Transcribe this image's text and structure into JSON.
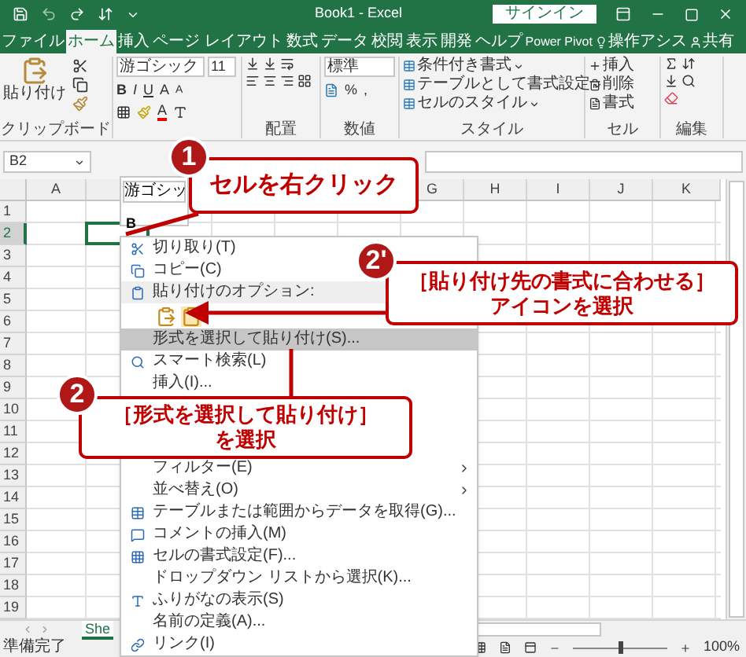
{
  "title_bar": {
    "title": "Book1  -  Excel",
    "sign_in": "サインイン"
  },
  "tabs": [
    {
      "label": "ファイル",
      "selected": false,
      "kind": "plain"
    },
    {
      "label": "ホーム",
      "selected": true,
      "kind": "plain"
    },
    {
      "label": "挿入",
      "selected": false,
      "kind": "plain"
    },
    {
      "label": "ページ レイアウト",
      "selected": false,
      "kind": "plain"
    },
    {
      "label": "数式",
      "selected": false,
      "kind": "plain"
    },
    {
      "label": "データ",
      "selected": false,
      "kind": "plain"
    },
    {
      "label": "校閲",
      "selected": false,
      "kind": "plain"
    },
    {
      "label": "表示",
      "selected": false,
      "kind": "plain"
    },
    {
      "label": "開発",
      "selected": false,
      "kind": "plain"
    },
    {
      "label": "ヘルプ",
      "selected": false,
      "kind": "plain"
    },
    {
      "label": "Power Pivot",
      "selected": false,
      "kind": "plain"
    },
    {
      "label": "操作アシス",
      "selected": false,
      "kind": "search"
    },
    {
      "label": "共有",
      "selected": false,
      "kind": "share"
    }
  ],
  "ribbon": {
    "clipboard": {
      "paste": "貼り付け",
      "label": "クリップボード"
    },
    "font": {
      "name": "游ゴシック",
      "size": "11",
      "styles": [
        "B",
        "I",
        "U"
      ],
      "grow": "A",
      "shrink": "A",
      "font_color_button": "A"
    },
    "alignment": {
      "label": "配置"
    },
    "number": {
      "format": "標準",
      "percent": "%",
      "comma": ",",
      "label": "数値"
    },
    "styles": {
      "items": [
        "条件付き書式",
        "テーブルとして書式設定",
        "セルのスタイル"
      ],
      "label": "スタイル"
    },
    "cells": {
      "items": [
        "挿入",
        "削除",
        "書式"
      ],
      "label": "セル"
    },
    "editing": {
      "label": "編集"
    }
  },
  "formula_bar": {
    "name_box": "B2"
  },
  "mini_toolbar": {
    "font": "游ゴシッ",
    "bold": "B"
  },
  "columns": [
    {
      "label": "A"
    },
    {
      "label": "G"
    },
    {
      "label": "H"
    },
    {
      "label": "I"
    },
    {
      "label": "J"
    },
    {
      "label": "K"
    }
  ],
  "rows": [
    {
      "label": "1",
      "selected": false
    },
    {
      "label": "2",
      "selected": true
    },
    {
      "label": "3",
      "selected": false
    },
    {
      "label": "4",
      "selected": false
    },
    {
      "label": "5",
      "selected": false
    },
    {
      "label": "6",
      "selected": false
    },
    {
      "label": "7",
      "selected": false
    },
    {
      "label": "8",
      "selected": false
    },
    {
      "label": "9",
      "selected": false
    },
    {
      "label": "10",
      "selected": false
    },
    {
      "label": "11",
      "selected": false
    },
    {
      "label": "12",
      "selected": false
    },
    {
      "label": "13",
      "selected": false
    },
    {
      "label": "14",
      "selected": false
    },
    {
      "label": "15",
      "selected": false
    },
    {
      "label": "16",
      "selected": false
    },
    {
      "label": "17",
      "selected": false
    },
    {
      "label": "18",
      "selected": false
    },
    {
      "label": "19",
      "selected": false
    }
  ],
  "context_menu": {
    "upper_items": [
      {
        "kind": "cut",
        "label": "切り取り(T)",
        "selected": false
      },
      {
        "kind": "copy",
        "label": "コピー(C)",
        "selected": false
      },
      {
        "kind": "heading",
        "label": "貼り付けのオプション:",
        "selected": false
      },
      {
        "kind": "paste-icons",
        "selected": false
      },
      {
        "kind": "plain",
        "label": "形式を選択して貼り付け(S)...",
        "selected": true
      },
      {
        "kind": "search",
        "label": "スマート検索(L)",
        "selected": false
      },
      {
        "kind": "plain",
        "label": "挿入(I)...",
        "selected": false
      }
    ],
    "lower_items": [
      {
        "kind": "submenu",
        "label": "フィルター(E)",
        "selected": false
      },
      {
        "kind": "submenu",
        "label": "並べ替え(O)",
        "selected": false
      },
      {
        "kind": "table",
        "label": "テーブルまたは範囲からデータを取得(G)...",
        "selected": false
      },
      {
        "kind": "comment",
        "label": "コメントの挿入(M)",
        "selected": false
      },
      {
        "kind": "format",
        "label": "セルの書式設定(F)...",
        "selected": false
      },
      {
        "kind": "plain",
        "label": "ドロップダウン リストから選択(K)...",
        "selected": false
      },
      {
        "kind": "furigana",
        "label": "ふりがなの表示(S)",
        "selected": false
      },
      {
        "kind": "plain",
        "label": "名前の定義(A)...",
        "selected": false
      },
      {
        "kind": "link",
        "label": "リンク(I)",
        "selected": false
      }
    ]
  },
  "sheet_tabs": [
    {
      "label": "She",
      "selected": true
    }
  ],
  "status_bar": {
    "text": "準備完了",
    "zoom": {
      "level": 0.5,
      "reading": "100%"
    }
  },
  "callouts": [
    {
      "number": "1",
      "lines": [
        "セルを右クリック"
      ]
    },
    {
      "number": "2'",
      "lines": [
        "［貼り付け先の書式に合わせる］",
        "アイコンを選択"
      ]
    },
    {
      "number": "2",
      "lines": [
        "［形式を選択して貼り付け］",
        "を選択"
      ]
    }
  ]
}
